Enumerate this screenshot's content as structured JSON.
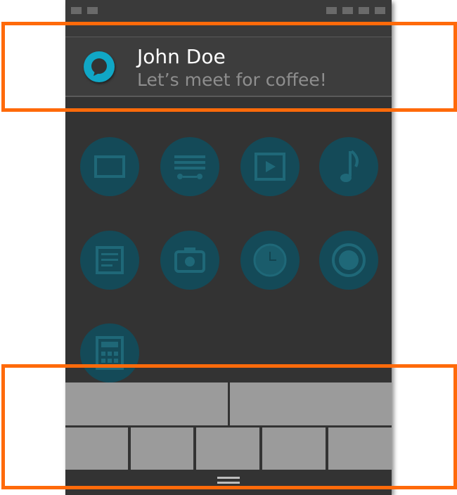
{
  "notification": {
    "sender": "John Doe",
    "message": "Let’s meet for coffee!",
    "app_icon": "chat-bubble-icon"
  },
  "status_bar": {
    "left_icons": [
      "status-icon",
      "status-icon"
    ],
    "right_icons": [
      "status-icon",
      "status-icon",
      "status-icon",
      "status-icon"
    ]
  },
  "app_grid": {
    "icons": [
      "tablet-icon",
      "radio-icon",
      "video-icon",
      "music-icon",
      "notes-icon",
      "camera-icon",
      "clock-icon",
      "record-icon",
      "calculator-icon"
    ]
  },
  "colors": {
    "background": "#333333",
    "app_icon": "#10a7c6",
    "dimmed_icon": "#144a58",
    "key": "#9b9b9b",
    "highlight_frame": "#ff6a0a"
  }
}
